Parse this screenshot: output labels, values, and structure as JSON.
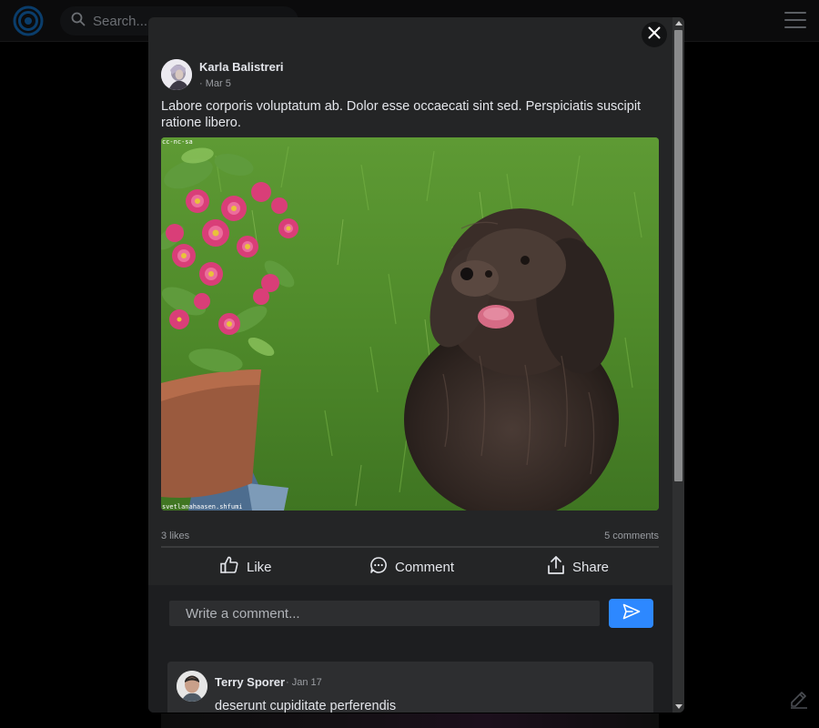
{
  "background": {
    "search_placeholder": "Search...",
    "accent_color": "#1e88e5"
  },
  "post": {
    "author": "Karla Balistreri",
    "date": "· Mar 5",
    "text": "Labore corporis voluptatum ab. Dolor esse occaecati sint sed. Perspiciatis suscipit ratione libero.",
    "image_credit_top": "cc-nc-sa",
    "image_credit_bottom": "svetlanahaasen.shfumi",
    "likes": "3 likes",
    "comments": "5 comments"
  },
  "actions": {
    "like": "Like",
    "comment": "Comment",
    "share": "Share"
  },
  "comment_box": {
    "placeholder": "Write a comment..."
  },
  "comments": [
    {
      "author": "Terry Sporer",
      "date": "· Jan 17",
      "text": "deserunt cupiditate perferendis"
    }
  ],
  "icons": {
    "close": "close-icon",
    "like": "thumbs-up-icon",
    "comment": "comment-bubble-icon",
    "share": "share-upload-icon",
    "send": "send-icon",
    "search": "search-icon",
    "menu": "hamburger-menu-icon",
    "compose": "compose-icon"
  },
  "colors": {
    "modal_bg": "#242526",
    "send_button": "#2d88ff",
    "page_bg": "#000000"
  }
}
